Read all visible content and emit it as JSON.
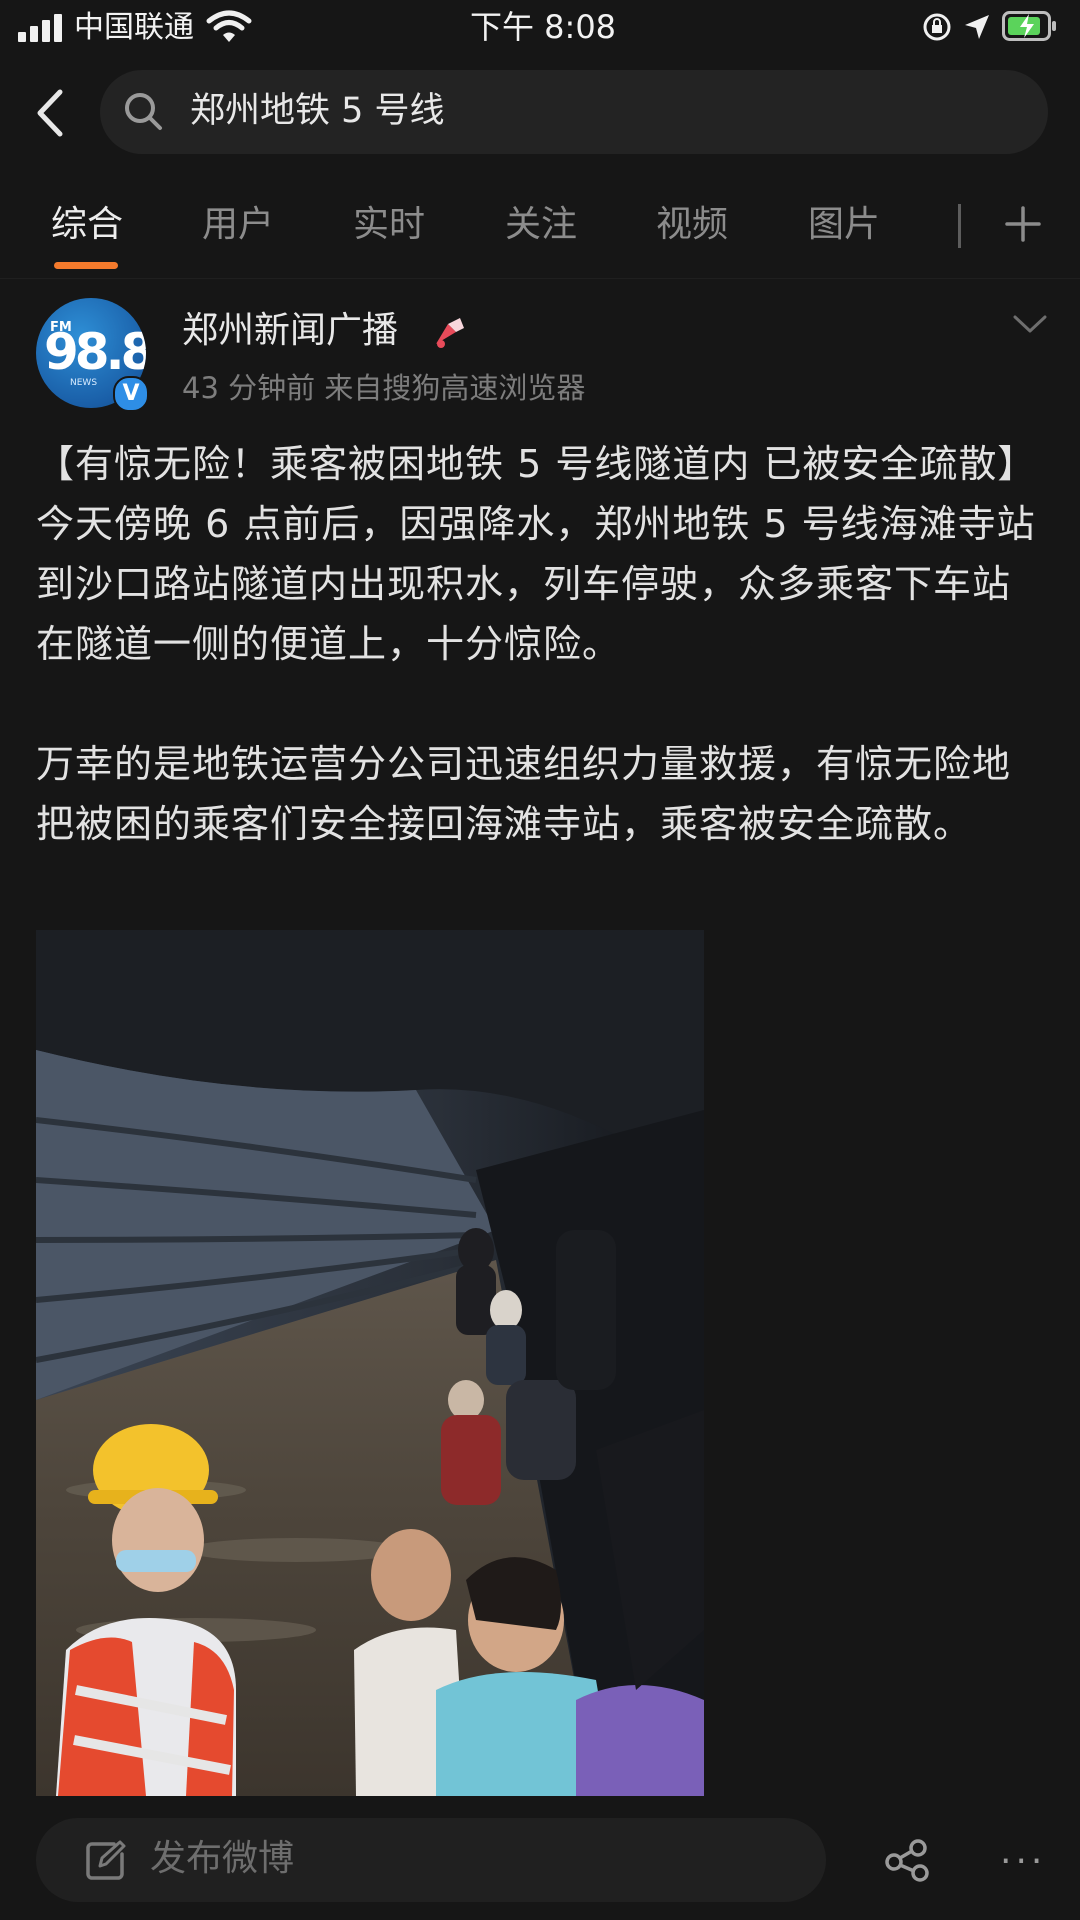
{
  "status_bar": {
    "carrier": "中国联通",
    "time": "下午 8:08"
  },
  "search": {
    "query": "郑州地铁 5 号线"
  },
  "tabs": [
    {
      "label": "综合",
      "active": true
    },
    {
      "label": "用户"
    },
    {
      "label": "实时"
    },
    {
      "label": "关注"
    },
    {
      "label": "视频"
    },
    {
      "label": "图片"
    }
  ],
  "post": {
    "author": "郑州新闻广播",
    "avatar_text": "98.8",
    "meta": "43 分钟前  来自搜狗高速浏览器",
    "paragraph1": "【有惊无险！乘客被困地铁 5 号线隧道内 已被安全疏散】今天傍晚 6 点前后，因强降水，郑州地铁 5 号线海滩寺站到沙口路站隧道内出现积水，列车停驶，众多乘客下车站在隧道一侧的便道上，十分惊险。",
    "paragraph2": "万幸的是地铁运营分公司迅速组织力量救援，有惊无险地把被困的乘客们安全接回海滩寺站，乘客被安全疏散。"
  },
  "bottom_bar": {
    "compose_placeholder": "发布微博"
  },
  "colors": {
    "background": "#161616",
    "accent": "#f47a2c",
    "battery": "#5bd35b"
  }
}
